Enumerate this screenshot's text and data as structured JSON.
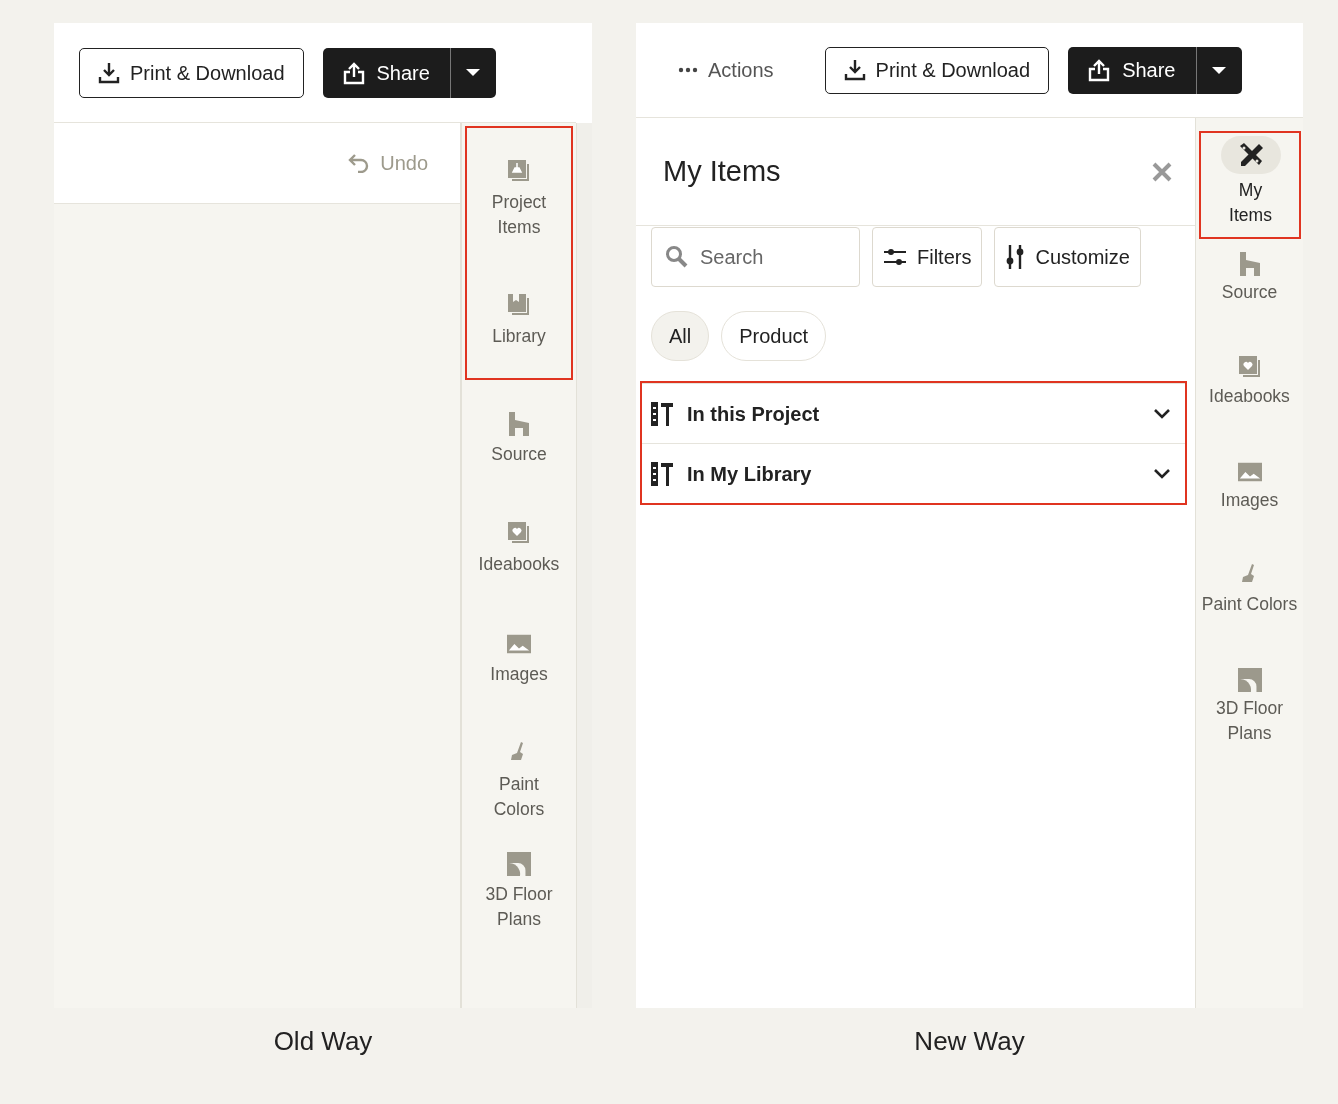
{
  "old_way": {
    "print_button": "Print & Download",
    "share_button": "Share",
    "undo": "Undo",
    "sidebar": [
      {
        "label": "Project Items",
        "selected": false,
        "highlighted": true
      },
      {
        "label": "Library",
        "selected": false,
        "highlighted": true
      },
      {
        "label": "Source",
        "selected": false,
        "highlighted": false
      },
      {
        "label": "Ideabooks",
        "selected": false,
        "highlighted": false
      },
      {
        "label": "Images",
        "selected": false,
        "highlighted": false
      },
      {
        "label": "Paint Colors",
        "selected": false,
        "highlighted": false
      },
      {
        "label": "3D Floor Plans",
        "selected": false,
        "highlighted": false
      }
    ],
    "caption": "Old Way"
  },
  "new_way": {
    "actions_button": "Actions",
    "print_button": "Print & Download",
    "share_button": "Share",
    "panel_title": "My Items",
    "search": {
      "placeholder": "Search"
    },
    "filters_button": "Filters",
    "customize_button": "Customize",
    "chips": [
      {
        "label": "All",
        "selected": true
      },
      {
        "label": "Product",
        "selected": false
      }
    ],
    "sections": [
      {
        "label": "In this Project",
        "expanded": false,
        "highlighted": true
      },
      {
        "label": "In My Library",
        "expanded": false,
        "highlighted": true
      }
    ],
    "sidebar": [
      {
        "label": "My Items",
        "selected": true,
        "highlighted": true
      },
      {
        "label": "Source",
        "selected": false,
        "highlighted": false
      },
      {
        "label": "Ideabooks",
        "selected": false,
        "highlighted": false
      },
      {
        "label": "Images",
        "selected": false,
        "highlighted": false
      },
      {
        "label": "Paint Colors",
        "selected": false,
        "highlighted": false
      },
      {
        "label": "3D Floor Plans",
        "selected": false,
        "highlighted": false
      }
    ],
    "caption": "New Way"
  }
}
